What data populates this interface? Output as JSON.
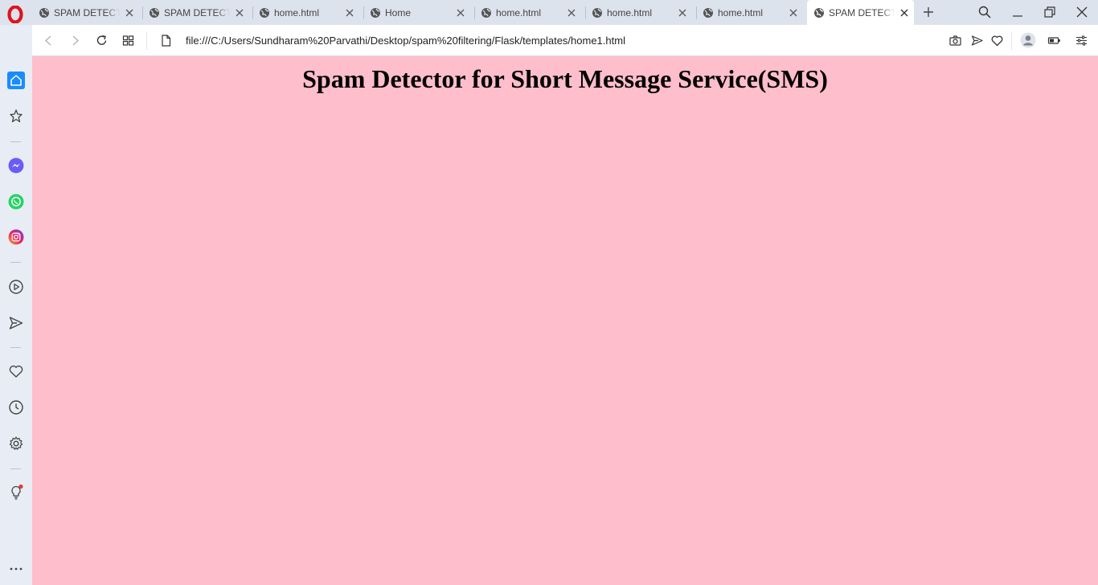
{
  "browser": {
    "tabs": [
      {
        "title": "SPAM DETECTION"
      },
      {
        "title": "SPAM DETECTION"
      },
      {
        "title": "home.html"
      },
      {
        "title": "Home"
      },
      {
        "title": "home.html"
      },
      {
        "title": "home.html"
      },
      {
        "title": "home.html"
      },
      {
        "title": "SPAM DETECTION"
      }
    ],
    "address": "file:///C:/Users/Sundharam%20Parvathi/Desktop/spam%20filtering/Flask/templates/home1.html"
  },
  "page": {
    "title": "Spam Detector for Short Message Service(SMS)",
    "background": "#ffbecb"
  },
  "colors": {
    "opera_red": "#e0131c",
    "sidebar_bg": "#e8edf5",
    "home_accent": "#1a8cff",
    "messenger": "#6a5cf8",
    "whatsapp": "#25d366",
    "notification": "#e53935"
  }
}
